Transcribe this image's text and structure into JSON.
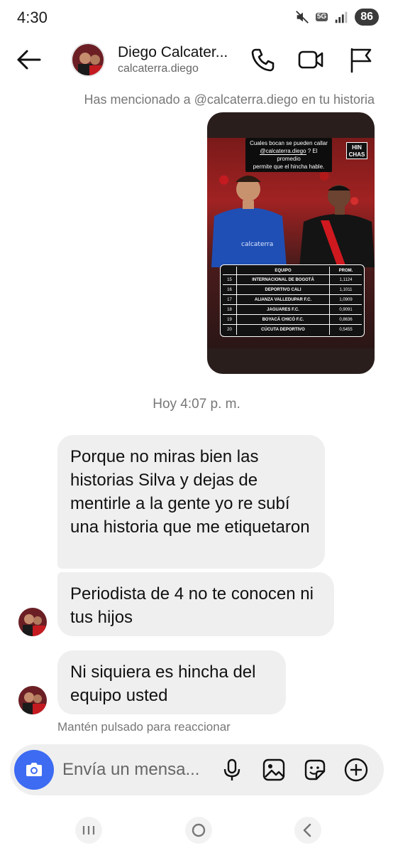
{
  "status_bar": {
    "time": "4:30",
    "network": "5G",
    "battery": "86"
  },
  "header": {
    "name": "Diego Calcater...",
    "username": "calcaterra.diego"
  },
  "mention_note": "Has mencionado a @calcaterra.diego en tu historia",
  "story": {
    "caption_line1": "Cuales bocan se pueden callar",
    "caption_mention": "@calcaterra.diego",
    "caption_line2": "? El promedio",
    "caption_line3": "permite que el hincha hable.",
    "logo_line1": "HIN",
    "logo_line2": "CHAS",
    "table": {
      "headers": [
        "EQUIPO",
        "PROM."
      ],
      "rows": [
        {
          "pos": "15",
          "team": "INTERNACIONAL DE BOGOTÁ",
          "prom": "1,1124"
        },
        {
          "pos": "16",
          "team": "DEPORTIVO CALI",
          "prom": "1,1011"
        },
        {
          "pos": "17",
          "team": "ALIANZA VALLEDUPAR F.C.",
          "prom": "1,0909"
        },
        {
          "pos": "18",
          "team": "JAGUARES F.C.",
          "prom": "0,9091"
        },
        {
          "pos": "19",
          "team": "BOYACÁ CHICÓ F.C.",
          "prom": "0,8636"
        },
        {
          "pos": "20",
          "team": "CÚCUTA DEPORTIVO",
          "prom": "0,5455"
        }
      ]
    }
  },
  "timestamp": "Hoy 4:07 p. m.",
  "messages": [
    {
      "text": "Porque no miras bien las historias Silva y dejas de mentirle a la gente yo re subí una historia que me etiquetaron"
    },
    {
      "text": "Periodista de 4 no te conocen ni tus hijos"
    },
    {
      "text": "Ni siquiera es hincha del equipo usted"
    }
  ],
  "hint": "Mantén pulsado para reaccionar",
  "composer": {
    "placeholder": "Envía un mensa..."
  },
  "colors": {
    "accent": "#3d6bf2",
    "bubble": "#efefef",
    "secondary_text": "#777777"
  },
  "icons": [
    "back-arrow-icon",
    "phone-icon",
    "video-camera-icon",
    "flag-icon",
    "camera-icon",
    "microphone-icon",
    "image-icon",
    "sticker-icon",
    "plus-icon",
    "recents-icon",
    "home-icon",
    "nav-back-icon"
  ]
}
